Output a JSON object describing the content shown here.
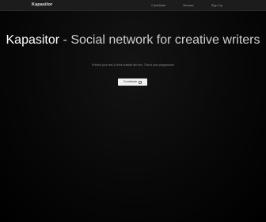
{
  "navbar": {
    "brand": "Kapasitor",
    "links": [
      {
        "label": "Contribute"
      },
      {
        "label": "Browse"
      },
      {
        "label": "Sign Up"
      }
    ]
  },
  "hero": {
    "brand_word": "Kapasitor",
    "tagline": " - Social network for creative writers",
    "subtitle": "Publish your text & think outside the box. This is your playground!",
    "cta_label": "Contribute",
    "cta_icon": "arrow-icon"
  },
  "colors": {
    "background": "#000000",
    "navbar": "#1c1c1c",
    "title": "#f0f0f0",
    "button_bg": "#f2f2f2"
  }
}
